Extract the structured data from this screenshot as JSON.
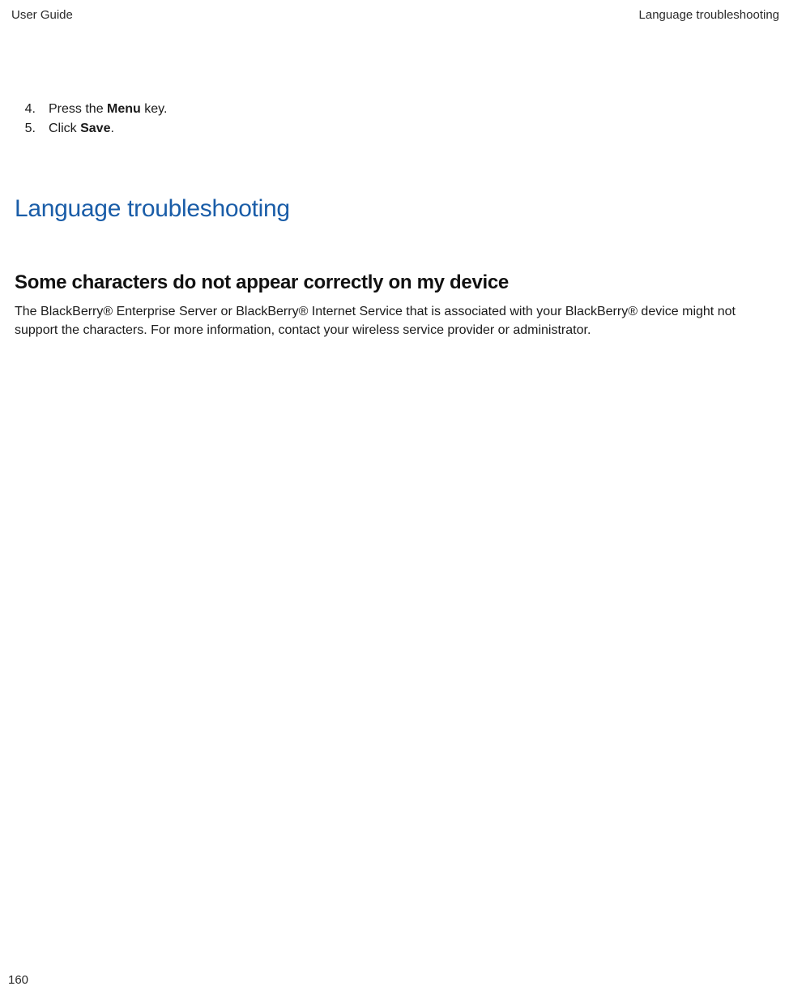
{
  "header": {
    "left": "User Guide",
    "right": "Language troubleshooting"
  },
  "steps": [
    {
      "number": "4.",
      "prefix": "Press the ",
      "bold": "Menu",
      "suffix": " key."
    },
    {
      "number": "5.",
      "prefix": "Click ",
      "bold": "Save",
      "suffix": "."
    }
  ],
  "heading1": "Language troubleshooting",
  "heading2": "Some characters do not appear correctly on my device",
  "paragraph": "The BlackBerry® Enterprise Server or BlackBerry® Internet Service that is associated with your BlackBerry® device might not support the characters. For more information, contact your wireless service provider or administrator.",
  "pageNumber": "160"
}
